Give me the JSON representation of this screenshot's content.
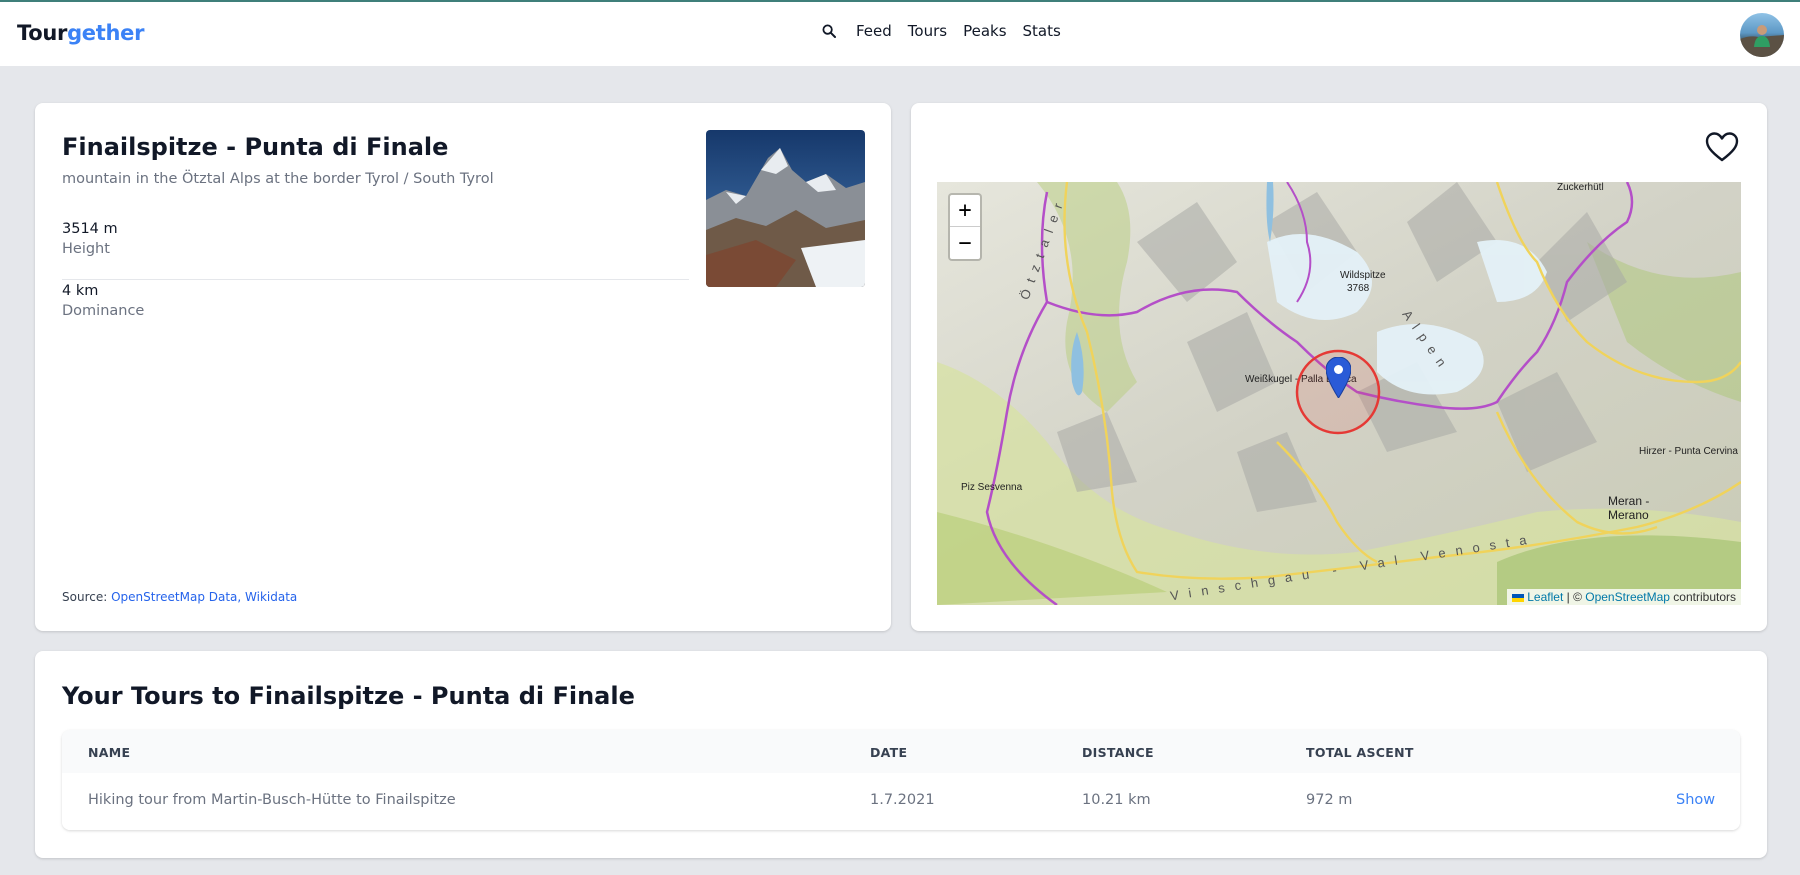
{
  "header": {
    "logo_part1": "Tour",
    "logo_part2": "gether",
    "nav": [
      "Feed",
      "Tours",
      "Peaks",
      "Stats"
    ]
  },
  "peak": {
    "title": "Finailspitze - Punta di Finale",
    "subtitle": "mountain in the Ötztal Alps at the border Tyrol / South Tyrol",
    "stats": [
      {
        "value": "3514 m",
        "label": "Height"
      },
      {
        "value": "4 km",
        "label": "Dominance"
      }
    ],
    "source_label": "Source:",
    "source_link": "OpenStreetMap Data, Wikidata"
  },
  "map": {
    "zoom_in": "+",
    "zoom_out": "−",
    "labels": [
      "Zuckerhütl",
      "Wildspitze",
      "3768",
      "Weißkugel - Palla Bianca",
      "Piz Sesvenna",
      "Hirzer - Punta Cervina",
      "Meran -",
      "Merano",
      "Vinschgau - Val Venosta",
      "Alpen",
      "Ötztaler"
    ],
    "attribution_leaflet": "Leaflet",
    "attribution_mid": " | © ",
    "attribution_osm": "OpenStreetMap",
    "attribution_end": " contributors"
  },
  "tours": {
    "title": "Your Tours to Finailspitze - Punta di Finale",
    "columns": [
      "NAME",
      "DATE",
      "DISTANCE",
      "TOTAL ASCENT"
    ],
    "rows": [
      {
        "name": "Hiking tour from Martin-Busch-Hütte to Finailspitze",
        "date": "1.7.2021",
        "distance": "10.21 km",
        "ascent": "972 m",
        "action": "Show"
      }
    ]
  },
  "colors": {
    "brand": "#3b82f6",
    "link": "#2563eb",
    "border_route": "#b44fc8",
    "marker": "#2a5bd7",
    "circle": "#e53935"
  }
}
